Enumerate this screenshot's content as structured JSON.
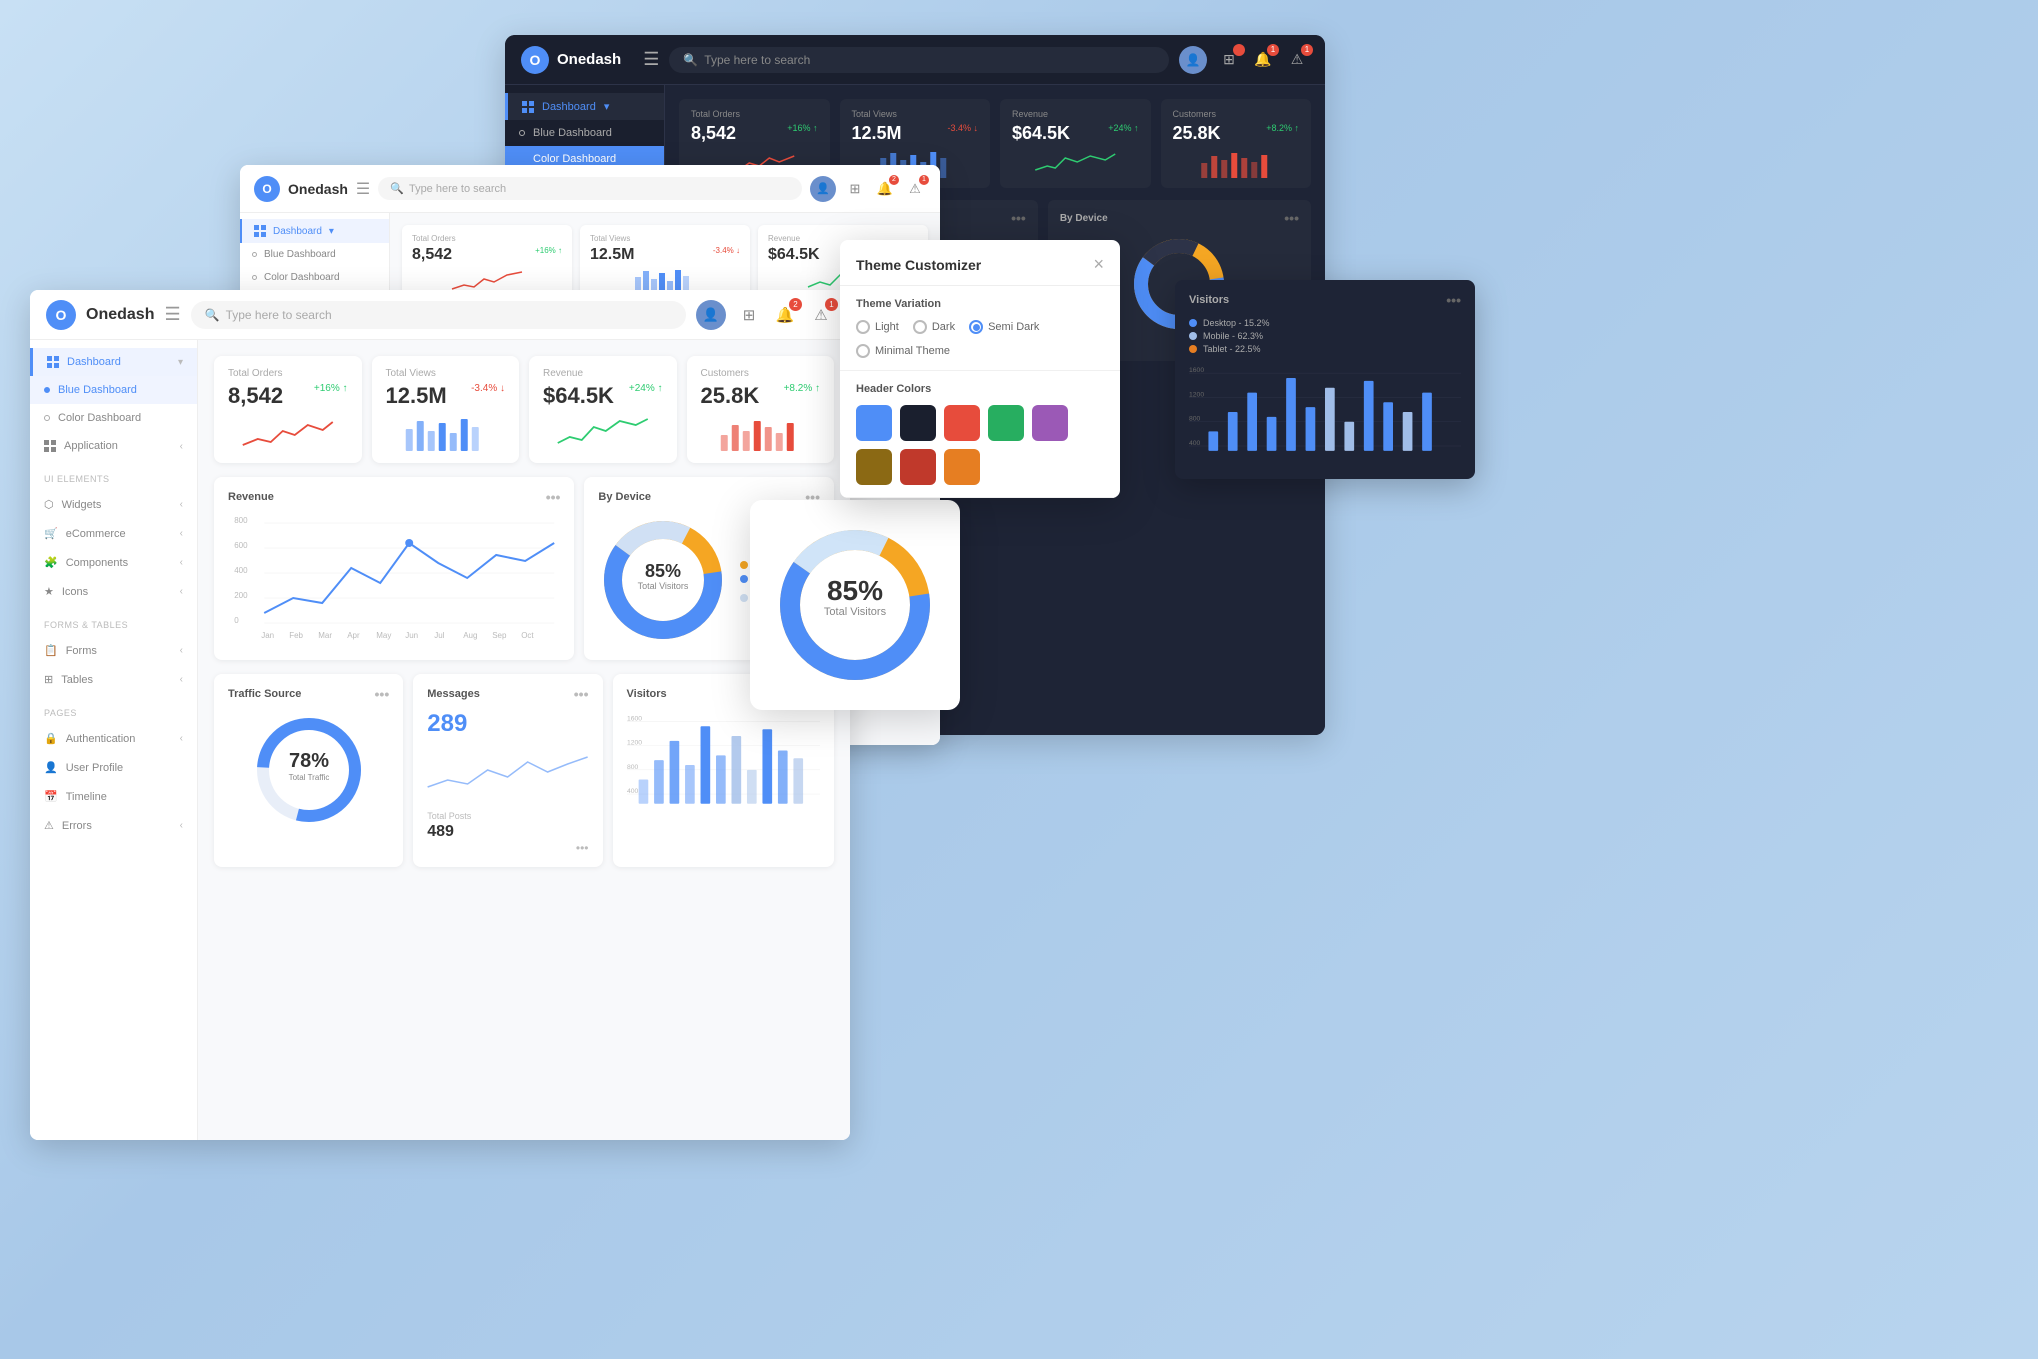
{
  "app": {
    "name": "Onedash",
    "logo_letter": "O",
    "search_placeholder": "Type here to search"
  },
  "nav": {
    "dashboard_label": "Dashboard",
    "blue_dashboard": "Blue Dashboard",
    "color_dashboard": "Color Dashboard",
    "application": "Application",
    "ui_elements": "UI ELEMENTS",
    "widgets": "Widgets",
    "ecommerce": "eCommerce",
    "components": "Components",
    "icons": "Icons",
    "forms_tables": "FORMS & TABLES",
    "forms": "Forms",
    "tables": "Tables",
    "pages": "PAGES",
    "authentication": "Authentication",
    "user_profile": "User Profile",
    "timeline": "Timeline",
    "errors": "Errors"
  },
  "stats": {
    "total_orders": {
      "label": "Total Orders",
      "value": "8,542",
      "change": "+16% ↑",
      "change_type": "pos"
    },
    "total_views": {
      "label": "Total Views",
      "value": "12.5M",
      "change": "-3.4% ↓",
      "change_type": "neg"
    },
    "revenue": {
      "label": "Revenue",
      "value": "$64.5K",
      "change": "+24% ↑",
      "change_type": "pos"
    },
    "customers": {
      "label": "Customers",
      "value": "25.8K",
      "change": "+8.2% ↑",
      "change_type": "pos"
    }
  },
  "revenue_chart": {
    "title": "Revenue",
    "y_labels": [
      "800",
      "600",
      "400",
      "200",
      "0"
    ],
    "x_labels": [
      "Jan",
      "Feb",
      "Mar",
      "Apr",
      "May",
      "Jun",
      "Jul",
      "Aug",
      "Sep",
      "Oct"
    ]
  },
  "device_chart": {
    "title": "By Device",
    "donut_pct": "85%",
    "donut_sub": "Total Visitors",
    "legend": [
      {
        "label": "Tablet - 22.5%",
        "color": "#f5a623"
      },
      {
        "label": "Mobile - 62.3%",
        "color": "#4f8ef7"
      },
      {
        "label": "Desktop - 15.2%",
        "color": "#c8d8f0"
      }
    ]
  },
  "traffic_chart": {
    "title": "Traffic Source",
    "donut_pct": "78%",
    "donut_sub": "Total Traffic"
  },
  "messages_chart": {
    "title": "Messages",
    "value": "289",
    "total_posts_label": "Total Posts",
    "total_posts_value": "489"
  },
  "visitors_chart": {
    "title": "Visitors",
    "bars": [
      600,
      900,
      1100,
      700,
      1400,
      800,
      1200,
      600,
      1300,
      1000,
      800,
      1100
    ],
    "y_max": 1600
  },
  "theme_customizer": {
    "title": "Theme Customizer",
    "section_variation": "Theme Variation",
    "options": [
      "Light",
      "Dark",
      "Semi Dark"
    ],
    "selected_option": "Semi Dark",
    "minimal_theme": "Minimal Theme",
    "section_colors": "Header Colors",
    "colors": [
      "#4f8ef7",
      "#1a1f2e",
      "#e74c3c",
      "#27ae60",
      "#9b59b6",
      "#8b6914",
      "#c0392b",
      "#e67e22"
    ]
  },
  "visitors_panel": {
    "title": "Visitors",
    "legend": [
      {
        "label": "Desktop - 15.2%",
        "color": "#4f8ef7"
      },
      {
        "label": "Mobile - 62.3%",
        "color": "#a0bde8"
      },
      {
        "label": "Tablet - 22.5%",
        "color": "#e67e22"
      }
    ]
  },
  "donut_big": {
    "pct": "85%",
    "sub": "Total Visitors"
  }
}
